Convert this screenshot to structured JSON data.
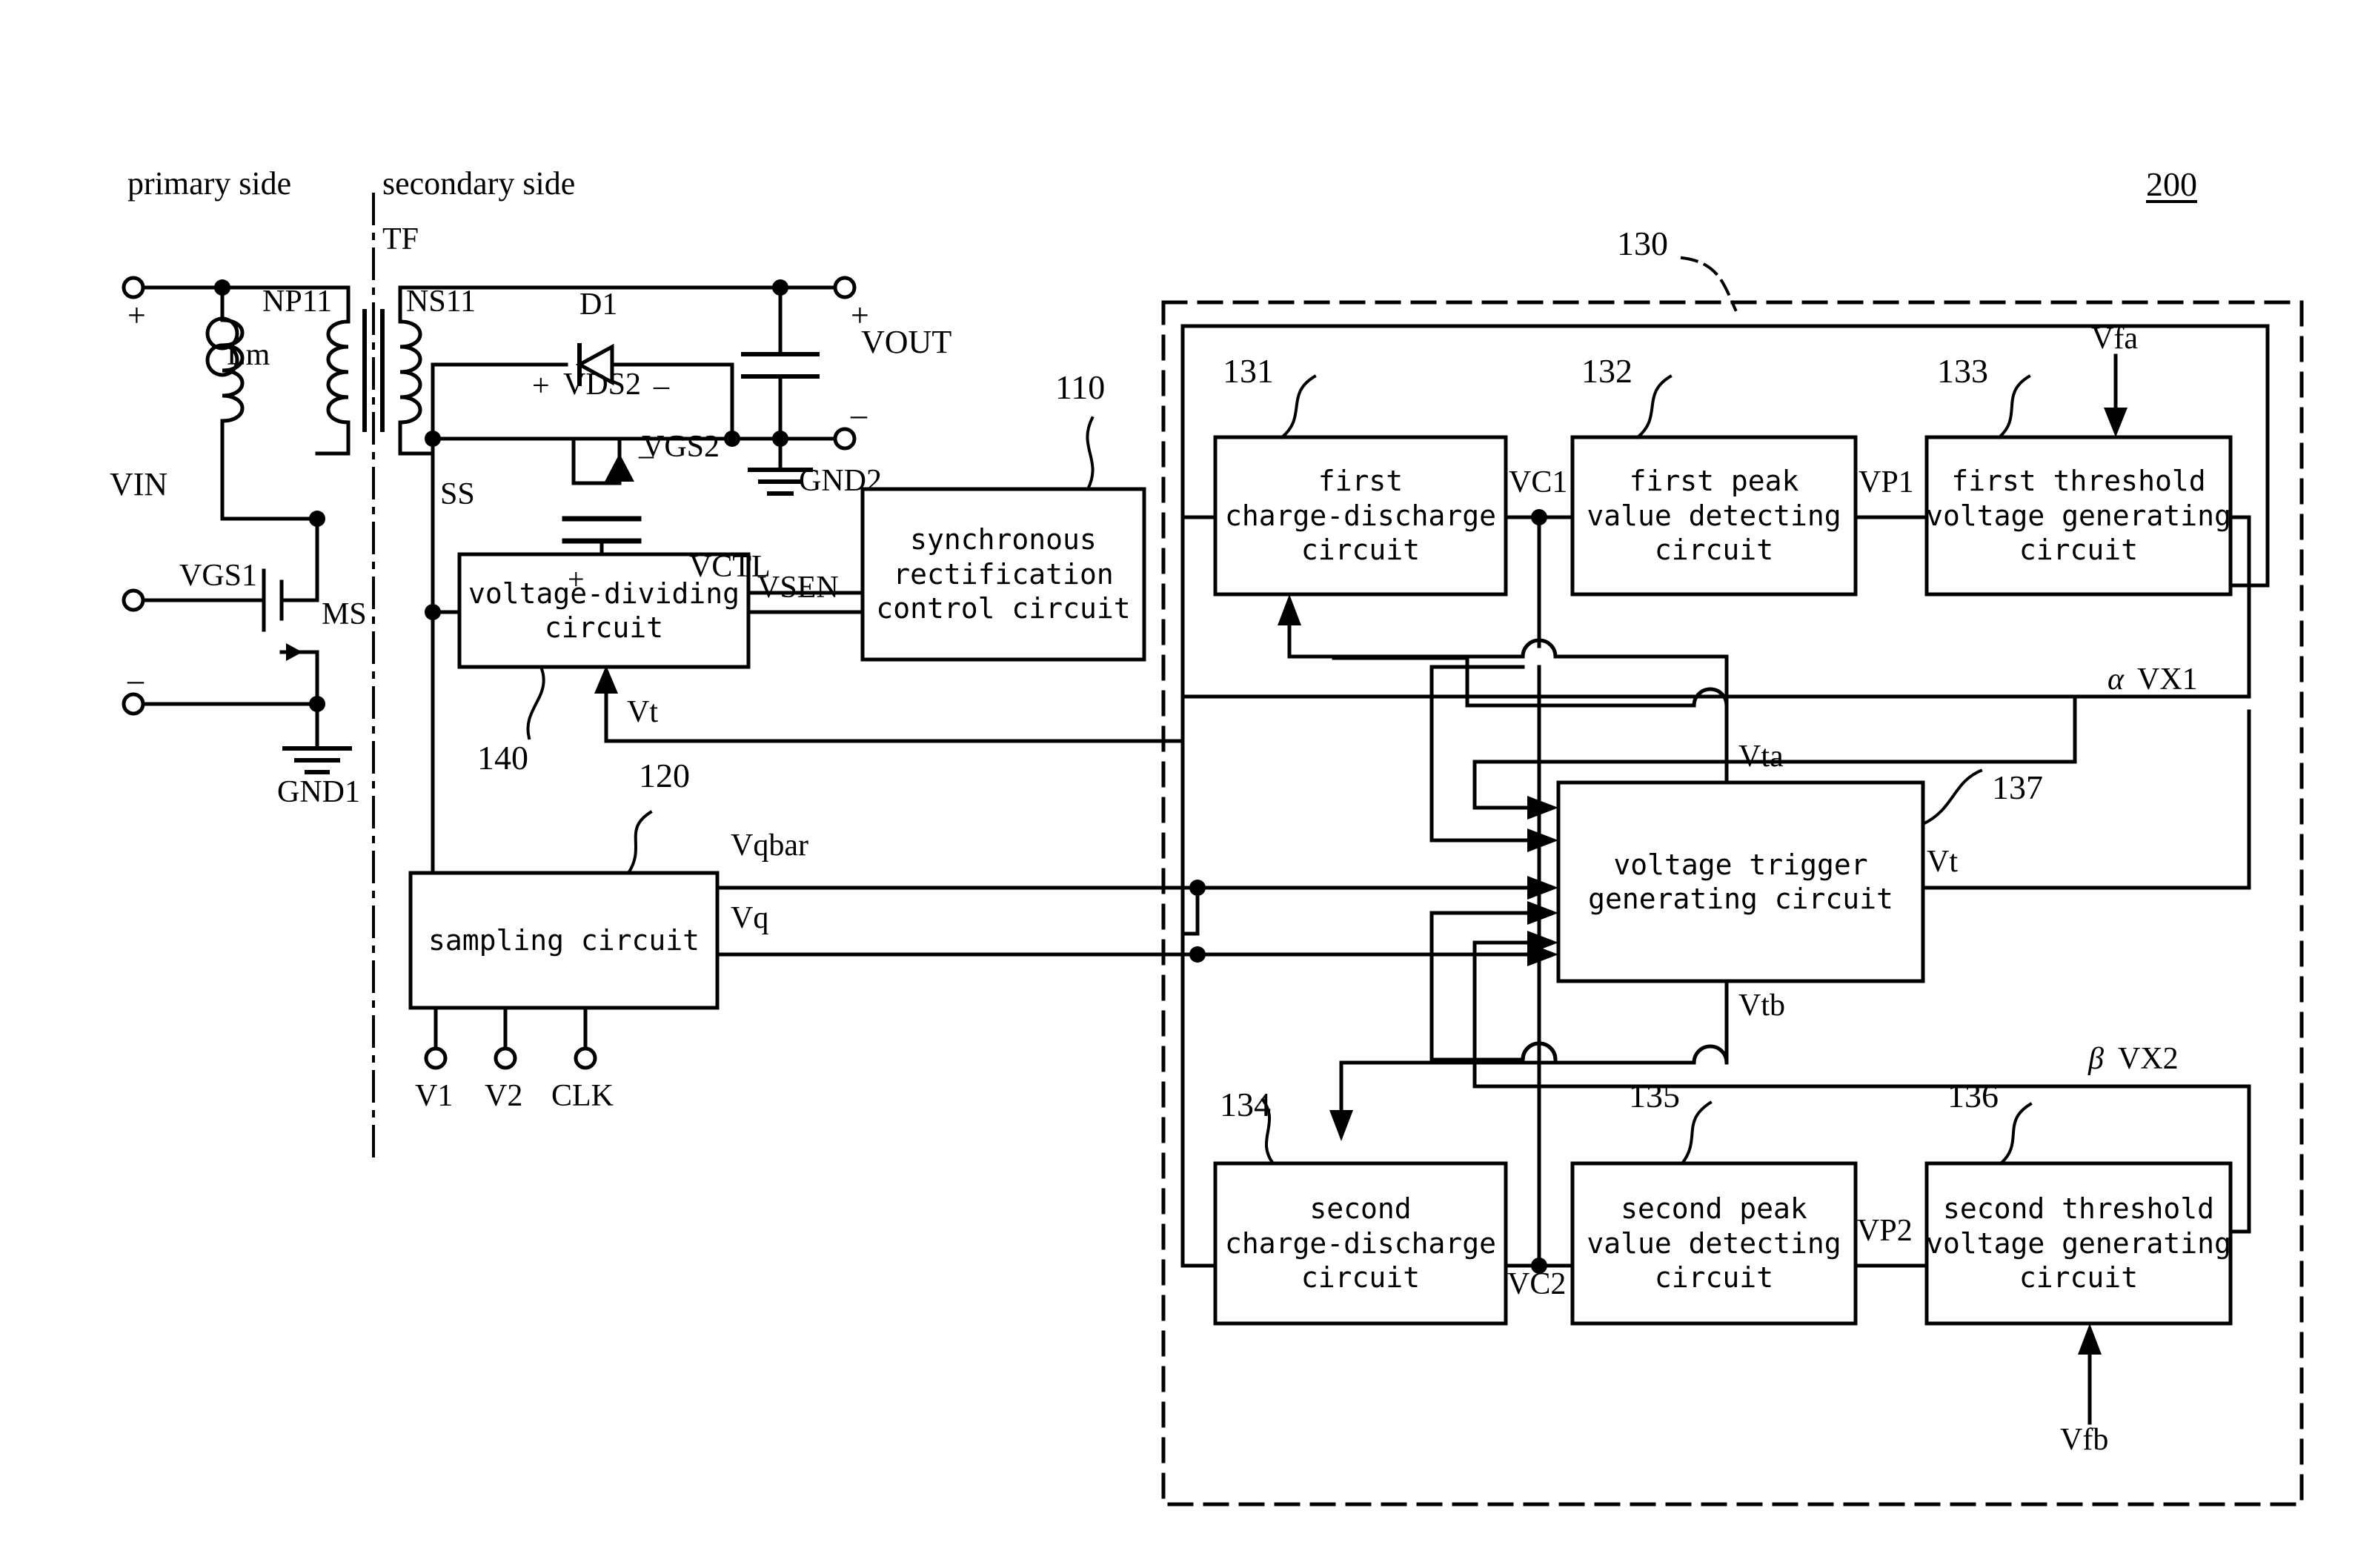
{
  "figure": {
    "ref_200": "200",
    "ref_130": "130",
    "ref_110": "110",
    "ref_120": "120",
    "ref_140": "140",
    "ref_131": "131",
    "ref_132": "132",
    "ref_133": "133",
    "ref_134": "134",
    "ref_135": "135",
    "ref_136": "136",
    "ref_137": "137"
  },
  "side_labels": {
    "primary": "primary side",
    "secondary": "secondary side"
  },
  "primary": {
    "transformer": "TF",
    "np": "NP11",
    "lm": "Lm",
    "vin": "VIN",
    "vgs1": "VGS1",
    "ms": "MS",
    "gnd1": "GND1",
    "plus": "+",
    "minus": "–"
  },
  "secondary": {
    "ns": "NS11",
    "d1": "D1",
    "vds2_plus": "+",
    "vds2": "VDS2",
    "vds2_minus": "–",
    "vgs2": "VGS2",
    "vgs2_plus": "+",
    "vgs2_minus": "–",
    "vout": "VOUT",
    "gnd2": "GND2",
    "out_plus": "+",
    "out_minus": "–",
    "ss": "SS",
    "vctl": "VCTL",
    "vsen": "VSEN"
  },
  "blocks": {
    "sync_rect": [
      "synchronous",
      "rectification",
      "control circuit"
    ],
    "voltage_divider": [
      "voltage-dividing",
      "circuit"
    ],
    "sampling": [
      "sampling circuit"
    ],
    "first_charge_discharge": [
      "first",
      "charge-discharge",
      "circuit"
    ],
    "first_peak": [
      "first peak",
      "value detecting",
      "circuit"
    ],
    "first_threshold": [
      "first threshold",
      "voltage generating",
      "circuit"
    ],
    "second_charge_discharge": [
      "second",
      "charge-discharge",
      "circuit"
    ],
    "second_peak": [
      "second peak",
      "value detecting",
      "circuit"
    ],
    "second_threshold": [
      "second threshold",
      "voltage generating",
      "circuit"
    ],
    "voltage_trigger": [
      "voltage trigger",
      "generating circuit"
    ]
  },
  "signals": {
    "vt": "Vt",
    "vqbar": "Vqbar",
    "vq": "Vq",
    "v1": "V1",
    "v2": "V2",
    "clk": "CLK",
    "vc1": "VC1",
    "vp1": "VP1",
    "vfa": "Vfa",
    "vc2": "VC2",
    "vp2": "VP2",
    "vfb": "Vfb",
    "vta": "Vta",
    "vtb": "Vtb",
    "alpha_vx1_sym": "α",
    "alpha_vx1_txt": "VX1",
    "beta_vx2_sym": "β",
    "beta_vx2_txt": "VX2"
  }
}
